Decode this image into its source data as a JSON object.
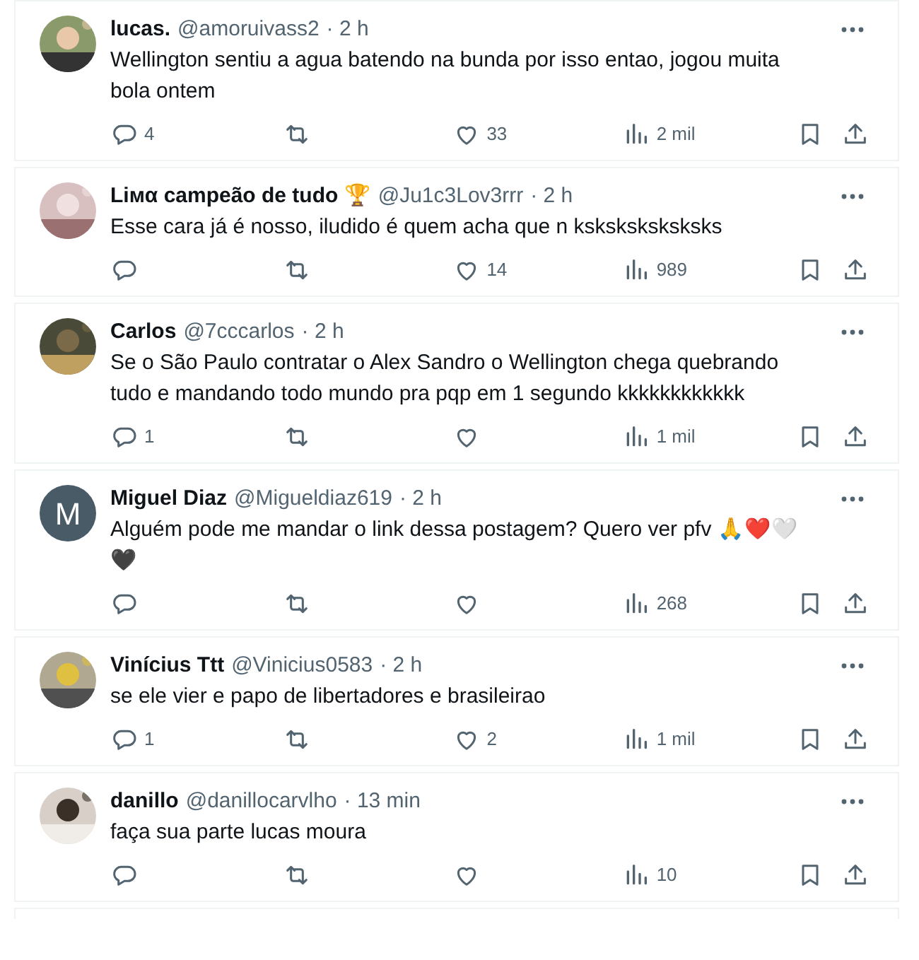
{
  "replies": [
    {
      "name": "lucas.",
      "handle": "@amoruivass2",
      "time": "· 2 h",
      "text": "Wellington sentiu a agua batendo na bunda por isso entao, jogou muita bola ontem",
      "replies": "4",
      "likes": "33",
      "views": "2 mil"
    },
    {
      "name": "Lімα campeão de tudo 🏆",
      "handle": "@Ju1c3Lov3rrr",
      "time": "· 2 h",
      "text": "Esse cara já é nosso, iludido é quem acha que n ksksksksksksks",
      "likes": "14",
      "views": "989"
    },
    {
      "name": "Carlos",
      "handle": "@7cccarlos",
      "time": "· 2 h",
      "text": "Se o São Paulo contratar o Alex Sandro o Wellington chega quebrando tudo e mandando todo mundo pra pqp em 1 segundo kkkkkkkkkkkk",
      "replies": "1",
      "views": "1 mil"
    },
    {
      "name": "Miguel Diaz",
      "handle": "@Migueldiaz619",
      "time": "· 2 h",
      "avatar": {
        "kind": "letter",
        "letter": "M",
        "color": "#4a5b68"
      },
      "text": "Alguém pode me mandar o link dessa postagem? Quero ver pfv 🙏❤️🤍🖤",
      "views": "268"
    },
    {
      "name": "Vinícius Ttt",
      "handle": "@Vinicius0583",
      "time": "· 2 h",
      "text": "se ele vier e papo de libertadores e brasileirao",
      "replies": "1",
      "likes": "2",
      "views": "1 mil"
    },
    {
      "name": "danillo",
      "handle": "@danillocarvlho",
      "time": "· 13 min",
      "text": "faça sua parte lucas moura",
      "views": "10"
    }
  ]
}
